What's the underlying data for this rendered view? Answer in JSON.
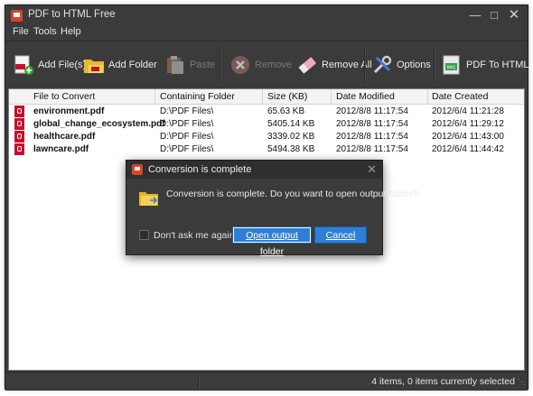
{
  "window": {
    "title": "PDF to HTML Free"
  },
  "menu": [
    "File",
    "Tools",
    "Help"
  ],
  "toolbar": {
    "add_files": "Add File(s)",
    "add_folder": "Add Folder",
    "paste": "Paste",
    "remove": "Remove",
    "remove_all": "Remove All",
    "options": "Options",
    "pdf_to_html": "PDF To HTML"
  },
  "table": {
    "columns": [
      "File to Convert",
      "Containing Folder",
      "Size (KB)",
      "Date Modified",
      "Date Created"
    ],
    "rows": [
      [
        "environment.pdf",
        "D:\\PDF Files\\",
        "65.63 KB",
        "2012/8/8 11:17:54",
        "2012/6/4 11:21:28"
      ],
      [
        "global_change_ecosystem.pdf",
        "D:\\PDF Files\\",
        "5405.14 KB",
        "2012/8/8 11:17:54",
        "2012/6/4 11:29:12"
      ],
      [
        "healthcare.pdf",
        "D:\\PDF Files\\",
        "3339.02 KB",
        "2012/8/8 11:17:54",
        "2012/6/4 11:43:00"
      ],
      [
        "lawncare.pdf",
        "D:\\PDF Files\\",
        "5494.38 KB",
        "2012/8/8 11:17:54",
        "2012/6/4 11:44:42"
      ]
    ]
  },
  "status": {
    "text": "4 items, 0 items currently selected"
  },
  "dialog": {
    "title": "Conversion is complete",
    "message": "Conversion is complete. Do you want to open output folder?",
    "checkbox_label": "Don't ask me again",
    "open_button": "Open output folder",
    "cancel_button": "Cancel"
  },
  "colors": {
    "chrome": "#3b3b3b",
    "accent": "#2f7fd6",
    "pdf_red": "#c8102e"
  }
}
